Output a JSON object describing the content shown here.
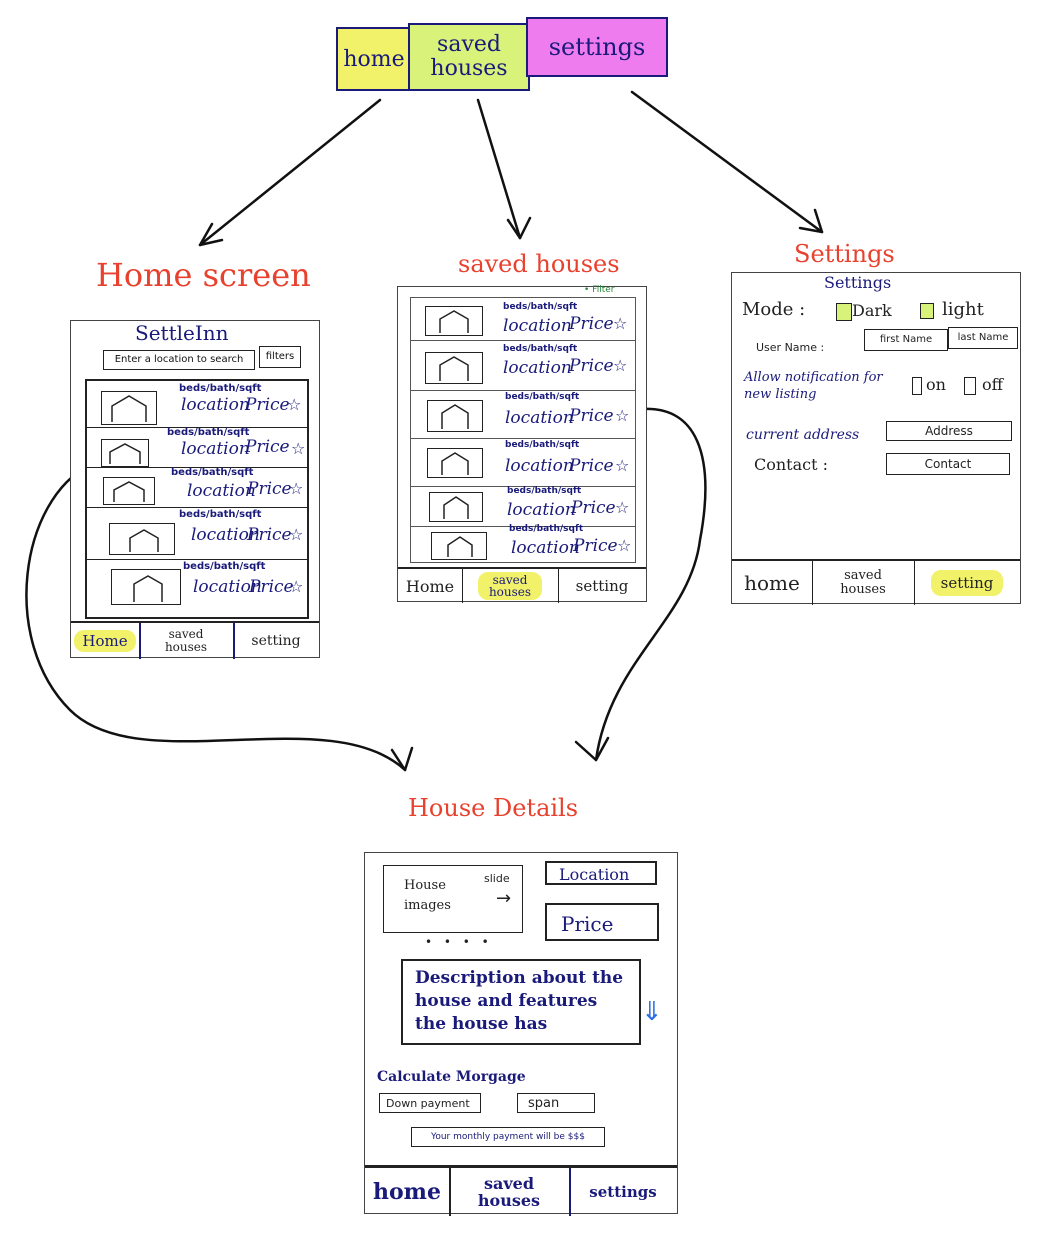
{
  "top_nav": {
    "home": "home",
    "saved_houses": "saved houses",
    "settings": "settings"
  },
  "titles": {
    "home_screen": "Home screen",
    "saved_houses": "saved houses",
    "settings": "Settings",
    "house_details": "House Details"
  },
  "home": {
    "app_name": "SettleInn",
    "search_placeholder": "Enter a location to search",
    "filters": "filters",
    "listings": [
      {
        "meta": "beds/bath/sqft",
        "location": "location",
        "price": "Price",
        "star": "☆"
      },
      {
        "meta": "beds/bath/sqft",
        "location": "location",
        "price": "Price",
        "star": "☆"
      },
      {
        "meta": "beds/bath/sqft",
        "location": "location",
        "price": "Price",
        "star": "☆"
      },
      {
        "meta": "beds/bath/sqft",
        "location": "location",
        "price": "Price",
        "star": "☆"
      },
      {
        "meta": "beds/bath/sqft",
        "location": "location",
        "price": "Price",
        "star": "☆"
      }
    ],
    "tabs": {
      "home": "Home",
      "saved": "saved houses",
      "setting": "setting"
    }
  },
  "saved": {
    "filter": "• Filter",
    "listings": [
      {
        "meta": "beds/bath/sqft",
        "location": "location",
        "price": "Price",
        "star": "☆"
      },
      {
        "meta": "beds/bath/sqft",
        "location": "location",
        "price": "Price",
        "star": "☆"
      },
      {
        "meta": "beds/bath/sqft",
        "location": "location",
        "price": "Price",
        "star": "☆"
      },
      {
        "meta": "beds/bath/sqft",
        "location": "location",
        "price": "Price",
        "star": "☆"
      },
      {
        "meta": "beds/bath/sqft",
        "location": "location",
        "price": "Price",
        "star": "☆"
      },
      {
        "meta": "beds/bath/sqft",
        "location": "location",
        "price": "Price",
        "star": "☆"
      }
    ],
    "tabs": {
      "home": "Home",
      "saved": "saved houses",
      "setting": "setting"
    }
  },
  "settings": {
    "heading": "Settings",
    "mode_label": "Mode :",
    "dark": "Dark",
    "light": "light",
    "username_label": "User Name :",
    "first_name": "first Name",
    "last_name": "last Name",
    "notif_label": "Allow notification for new listing",
    "on": "on",
    "off": "off",
    "address_label": "current address",
    "address_field": "Address",
    "contact_label": "Contact :",
    "contact_field": "Contact",
    "tabs": {
      "home": "home",
      "saved": "saved houses",
      "setting": "setting"
    }
  },
  "details": {
    "house_images": "House images",
    "slide": "slide",
    "arrow": "→",
    "dots": "• • • •",
    "location": "Location",
    "price": "Price",
    "description": "Description about the house and features the house has",
    "scroll_arrow": "⇓",
    "mortgage_title": "Calculate Morgage",
    "down_payment": "Down payment",
    "span": "span",
    "monthly": "Your monthly payment will be $$$",
    "tabs": {
      "home": "home",
      "saved": "saved houses",
      "settings": "settings"
    }
  },
  "colors": {
    "title_red": "#e8412e",
    "ink_navy": "#1a1a7a",
    "highlight_yellow": "#f2f26a",
    "highlight_green": "#d8f27a",
    "highlight_pink": "#ee7cee",
    "filter_green": "#2a8a3a",
    "scroll_blue": "#2a6de8"
  }
}
